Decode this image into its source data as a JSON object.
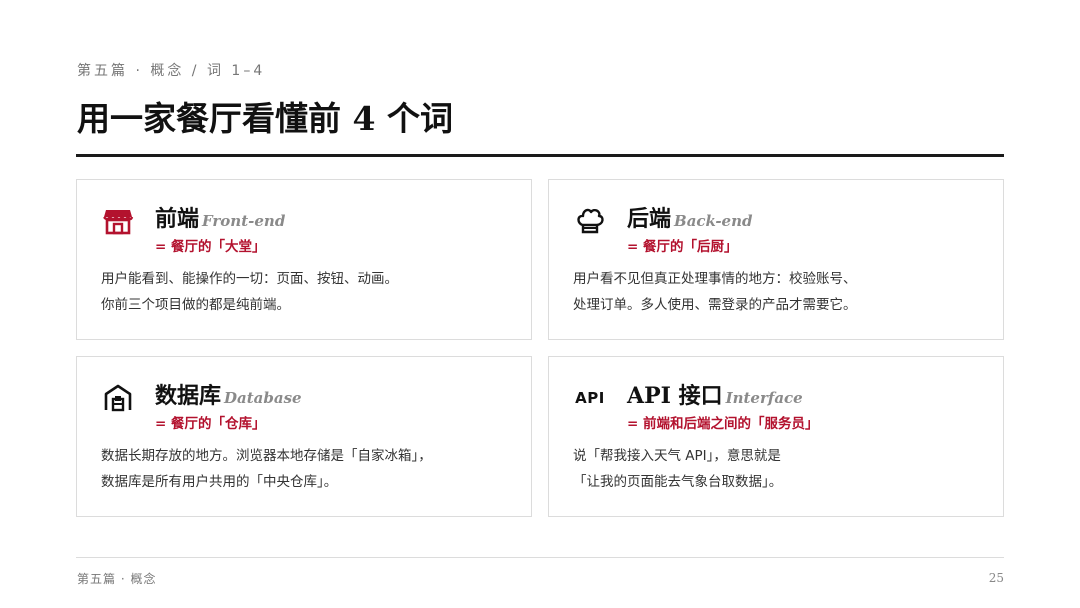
{
  "header": {
    "eyebrow": "第五篇 · 概念 / 词 1–4",
    "title": "用一家餐厅看懂前 4 个词"
  },
  "colors": {
    "accent": "#b3122e",
    "text": "#222222",
    "muted": "#777777",
    "border": "#dcdcdc"
  },
  "cards": [
    {
      "icon": "storefront-icon",
      "name": "前端",
      "en": "Front-end",
      "sub": "= 餐厅的「大堂」",
      "lines": [
        "用户能看到、能操作的一切：页面、按钮、动画。",
        "你前三个项目做的都是纯前端。"
      ]
    },
    {
      "icon": "chef-hat-icon",
      "name": "后端",
      "en": "Back-end",
      "sub": "= 餐厅的「后厨」",
      "lines": [
        "用户看不见但真正处理事情的地方：校验账号、",
        "处理订单。多人使用、需登录的产品才需要它。"
      ]
    },
    {
      "icon": "warehouse-icon",
      "name": "数据库",
      "en": "Database",
      "sub": "= 餐厅的「仓库」",
      "lines": [
        "数据长期存放的地方。浏览器本地存储是「自家冰箱」，",
        "数据库是所有用户共用的「中央仓库」。"
      ]
    },
    {
      "icon": "api-icon",
      "icon_text": "API",
      "name": "API 接口",
      "en": "Interface",
      "sub": "= 前端和后端之间的「服务员」",
      "lines": [
        "说「帮我接入天气 API」，意思就是",
        "「让我的页面能去气象台取数据」。"
      ]
    }
  ],
  "footer": {
    "section": "第五篇 · 概念",
    "page_number": "25"
  }
}
